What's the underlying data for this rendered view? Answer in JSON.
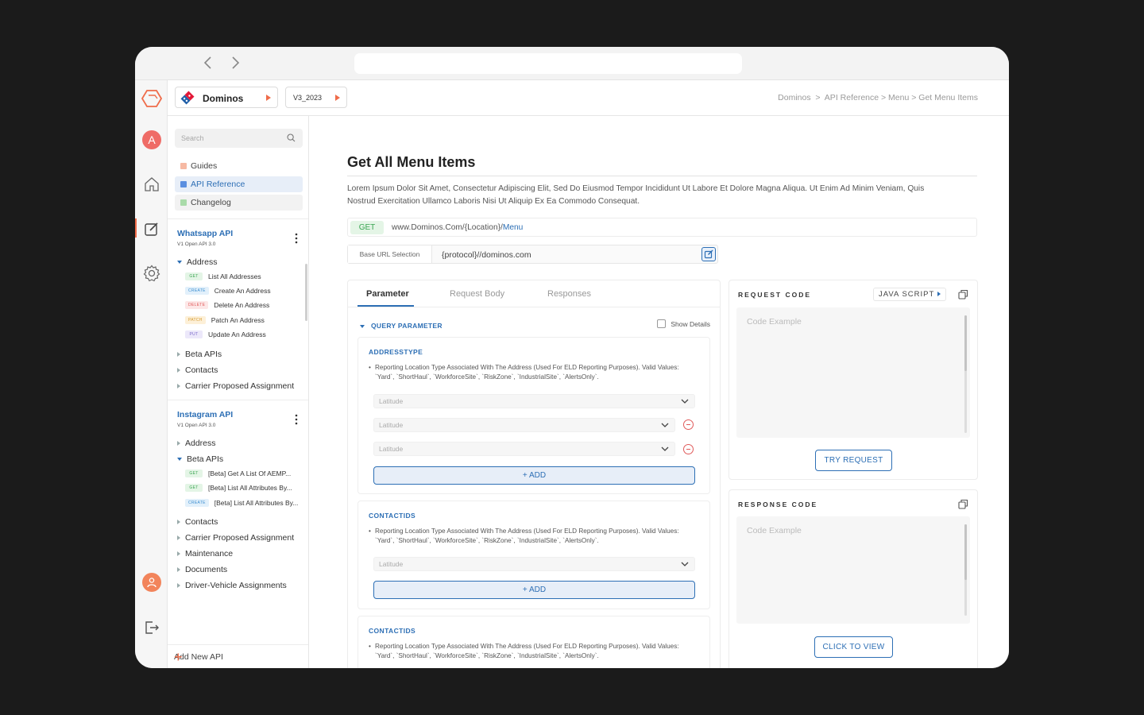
{
  "browser": {
    "url": ""
  },
  "header": {
    "project_name": "Dominos",
    "version": "V3_2023",
    "breadcrumb": "Dominos  >  API Reference > Menu > Get Menu Items"
  },
  "sidebar": {
    "search_placeholder": "Search",
    "nav": [
      {
        "label": "Guides",
        "color": "#f6b9a3"
      },
      {
        "label": "API Reference",
        "color": "#5b8fe0"
      },
      {
        "label": "Changelog",
        "color": "#a9dba9"
      }
    ],
    "apis": [
      {
        "title": "Whatsapp API",
        "subtitle": "V1 Open API 3.0",
        "groups": [
          {
            "label": "Address",
            "expanded": true
          },
          {
            "label": "Beta APIs"
          },
          {
            "label": "Contacts"
          },
          {
            "label": "Carrier Proposed Assignment"
          }
        ],
        "endpoints": [
          {
            "method": "GET",
            "label": "List All Addresses"
          },
          {
            "method": "CREATE",
            "label": "Create An Address"
          },
          {
            "method": "DELETE",
            "label": "Delete An Address"
          },
          {
            "method": "PATCH",
            "label": "Patch An Address"
          },
          {
            "method": "PUT",
            "label": "Update An Address"
          }
        ]
      },
      {
        "title": "Instagram API",
        "subtitle": "V1 Open API 3.0",
        "groups": [
          {
            "label": "Address"
          },
          {
            "label": "Beta APIs",
            "expanded": true
          },
          {
            "label": "Contacts"
          },
          {
            "label": "Carrier Proposed Assignment"
          },
          {
            "label": "Maintenance"
          },
          {
            "label": "Documents"
          },
          {
            "label": "Driver-Vehicle Assignments"
          }
        ],
        "endpoints": [
          {
            "method": "GET",
            "label": "[Beta] Get A List Of AEMP..."
          },
          {
            "method": "GET",
            "label": "[Beta] List All Attributes By..."
          },
          {
            "method": "CREATE",
            "label": "[Beta] List All Attributes By..."
          }
        ]
      }
    ],
    "add_api_label": "Add New API"
  },
  "main": {
    "title": "Get All Menu Items",
    "description": "Lorem Ipsum Dolor Sit Amet, Consectetur Adipiscing Elit, Sed Do Eiusmod Tempor Incididunt Ut Labore Et Dolore Magna Aliqua. Ut Enim Ad Minim Veniam, Quis Nostrud Exercitation Ullamco Laboris Nisi Ut Aliquip Ex Ea Commodo Consequat.",
    "endpoint": {
      "method": "GET",
      "url_prefix": "www.Dominos.Com/{Location}/",
      "url_tail": "Menu"
    },
    "base_url": {
      "label": "Base URL Selection",
      "value": "{protocol}//dominos.com"
    },
    "tabs": [
      {
        "label": "Parameter",
        "active": true
      },
      {
        "label": "Request Body"
      },
      {
        "label": "Responses"
      }
    ],
    "query_parameter_label": "QUERY PARAMETER",
    "show_details_label": "Show Details",
    "params": [
      {
        "title": "ADDRESSTYPE",
        "description": "Reporting Location Type Associated With The Address (Used For ELD Reporting Purposes). Valid Values: `Yard`, `ShortHaul`, `WorkforceSite`, `RiskZone`, `IndustrialSite`, `AlertsOnly`.",
        "selects": [
          "Latitude",
          "Latitude",
          "Latitude"
        ],
        "add_label": "+ ADD"
      },
      {
        "title": "CONTACTIDS",
        "description": "Reporting Location Type Associated With The Address (Used For ELD Reporting Purposes). Valid Values: `Yard`, `ShortHaul`, `WorkforceSite`, `RiskZone`, `IndustrialSite`, `AlertsOnly`.",
        "selects": [
          "Latitude"
        ],
        "add_label": "+ ADD"
      },
      {
        "title": "CONTACTIDS",
        "description": "Reporting Location Type Associated With The Address (Used For ELD Reporting Purposes). Valid Values: `Yard`, `ShortHaul`, `WorkforceSite`, `RiskZone`, `IndustrialSite`, `AlertsOnly`."
      }
    ],
    "request_code": {
      "title": "REQUEST CODE",
      "language": "JAVA SCRIPT",
      "placeholder": "Code Example",
      "button": "TRY  REQUEST"
    },
    "response_code": {
      "title": "RESPONSE CODE",
      "placeholder": "Code Example",
      "button": "CLICK TO VIEW"
    }
  },
  "colors": {
    "accent": "#2d6fb5",
    "brand": "#ef6c4a"
  }
}
